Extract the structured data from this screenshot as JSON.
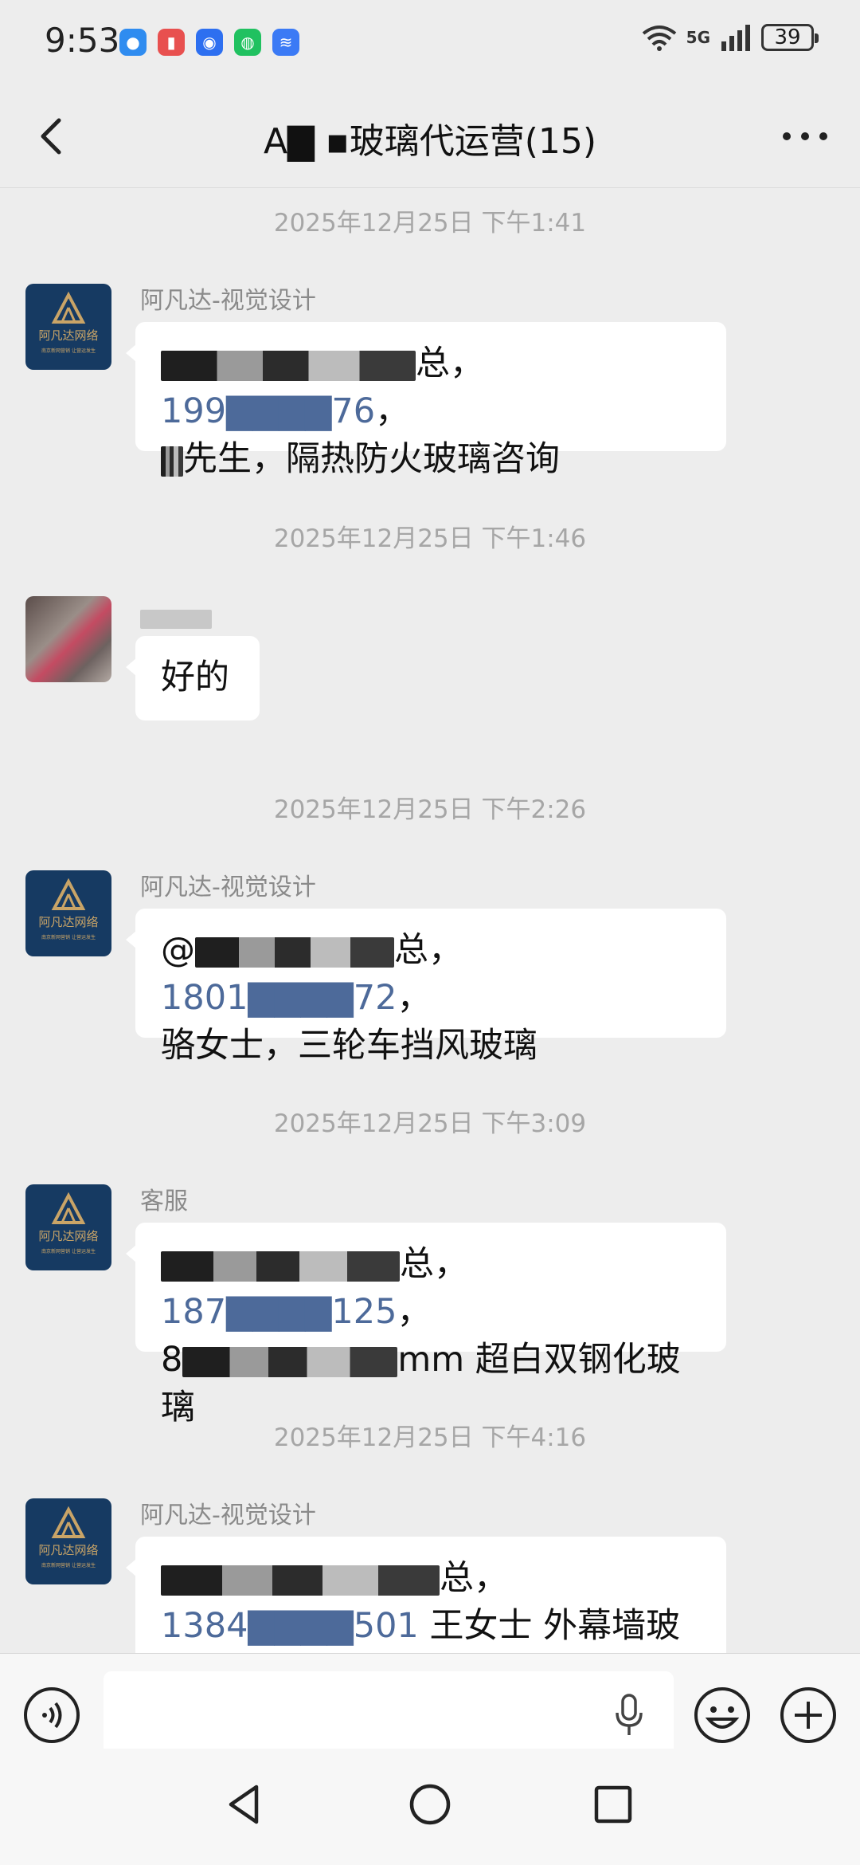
{
  "status_bar": {
    "time": "9:53",
    "network": "5G",
    "battery": "39"
  },
  "header": {
    "title": "A▇ ▪玻璃代运营(15)"
  },
  "messages": [
    {
      "timestamp": "2025年12月25日 下午1:41",
      "sender": "阿凡达-视觉设计",
      "avatar": "brand-logo",
      "lines": [
        {
          "pre": "",
          "blur_w": 320,
          "text": "总，",
          "phone": "199▇▇▇▇76",
          "post": "，"
        },
        {
          "pre": "",
          "blur_w": 28,
          "text": "先生，隔热防火玻璃咨询"
        }
      ]
    },
    {
      "timestamp": "2025年12月25日 下午1:46",
      "sender": "",
      "avatar": "photo",
      "lines": [
        {
          "text": "好的"
        }
      ]
    },
    {
      "timestamp": "2025年12月25日 下午2:26",
      "sender": "阿凡达-视觉设计",
      "avatar": "brand-logo",
      "lines": [
        {
          "pre": "@",
          "blur_w": 270,
          "text": "总，",
          "phone": "1801▇▇▇▇72",
          "post": "，"
        },
        {
          "text": "骆女士，三轮车挡风玻璃"
        }
      ]
    },
    {
      "timestamp": "2025年12月25日 下午3:09",
      "sender": "客服",
      "avatar": "brand-logo",
      "lines": [
        {
          "pre": "",
          "blur_w": 300,
          "text": "总，",
          "phone": "187▇▇▇▇125",
          "post": "，"
        },
        {
          "pre": "8",
          "blur_w": 300,
          "text": "mm 超白双钢化玻璃"
        }
      ]
    },
    {
      "timestamp": "2025年12月25日 下午4:16",
      "sender": "阿凡达-视觉设计",
      "avatar": "brand-logo",
      "lines": [
        {
          "pre": "",
          "blur_w": 350,
          "text": "总，"
        },
        {
          "phone": "1384▇▇▇▇501",
          "text": " 王女士  外幕墙玻"
        }
      ]
    }
  ],
  "brand": {
    "logo_text": "阿凡达网络",
    "logo_sub": "南京新网营销 让营运发生"
  },
  "colors": {
    "background": "#ededed",
    "bubble": "#ffffff",
    "phone_link": "#4d6a9a",
    "brand_bg": "#163a62",
    "brand_gold": "#c9a467"
  }
}
